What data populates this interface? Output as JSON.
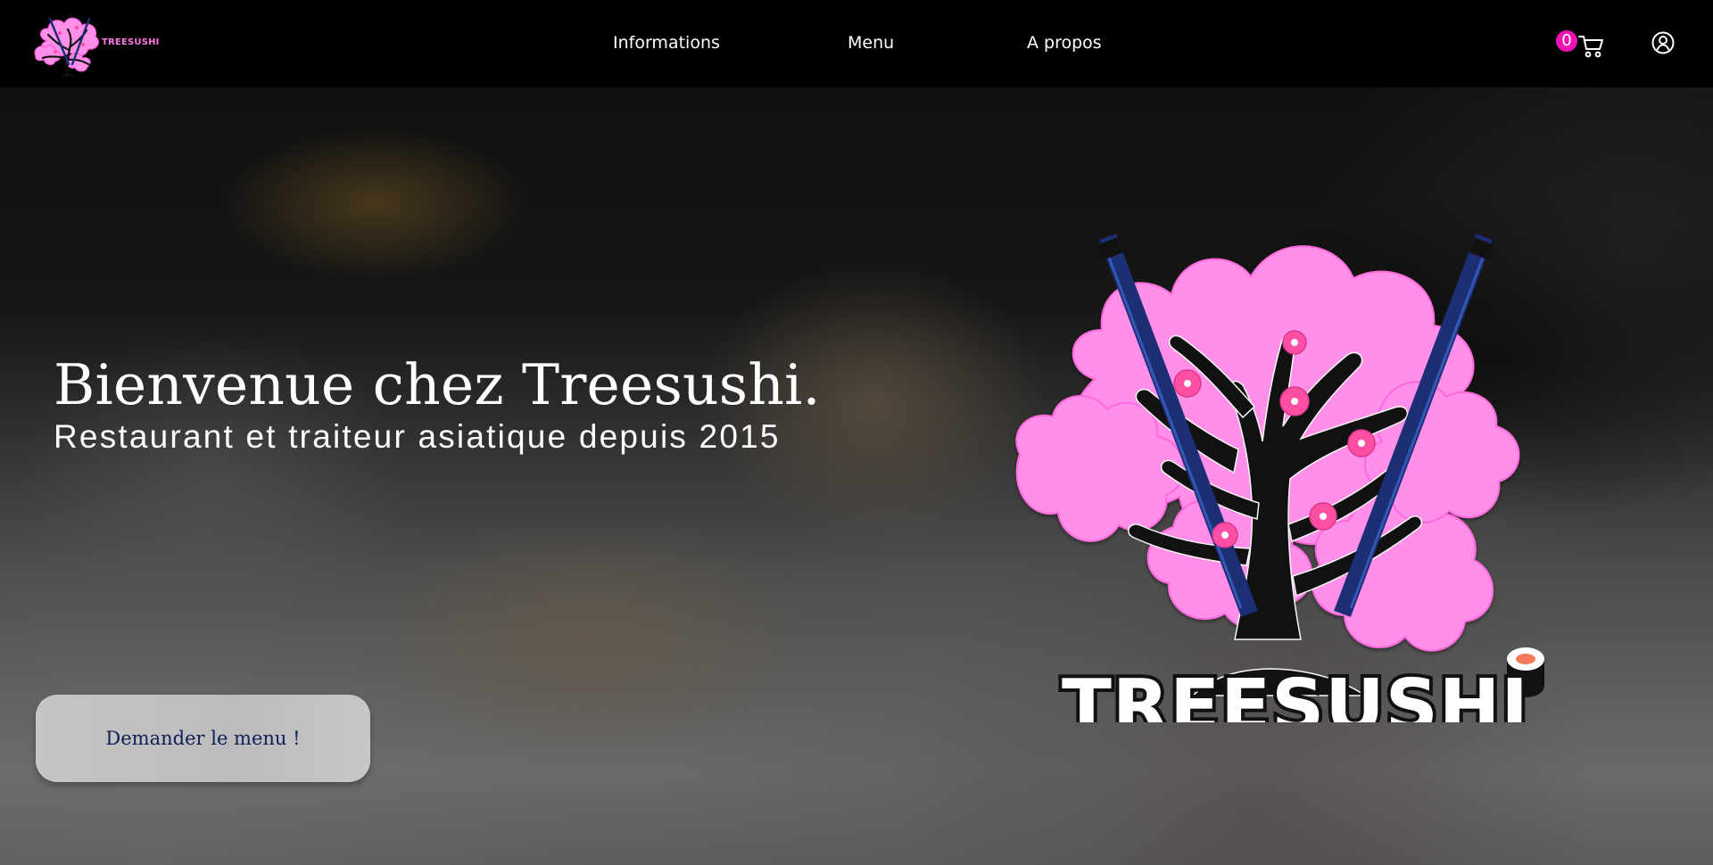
{
  "brand": {
    "name": "TREESUSHI"
  },
  "nav": {
    "items": [
      {
        "label": "Informations"
      },
      {
        "label": "Menu"
      },
      {
        "label": "A propos"
      }
    ]
  },
  "header": {
    "cart_count": "0",
    "icons": [
      "shopping-cart-icon",
      "user-account-icon"
    ]
  },
  "hero": {
    "title": "Bienvenue chez Treesushi.",
    "subtitle": "Restaurant et traiteur asiatique depuis 2015",
    "button_label": "Demander le menu !",
    "logo_text": "TREESUSHI"
  },
  "colors": {
    "accent": "#EE14B4",
    "button_text": "#0F1E57",
    "logo_pink": "#FF8FE8",
    "chopstick_blue": "#1C2E74"
  }
}
